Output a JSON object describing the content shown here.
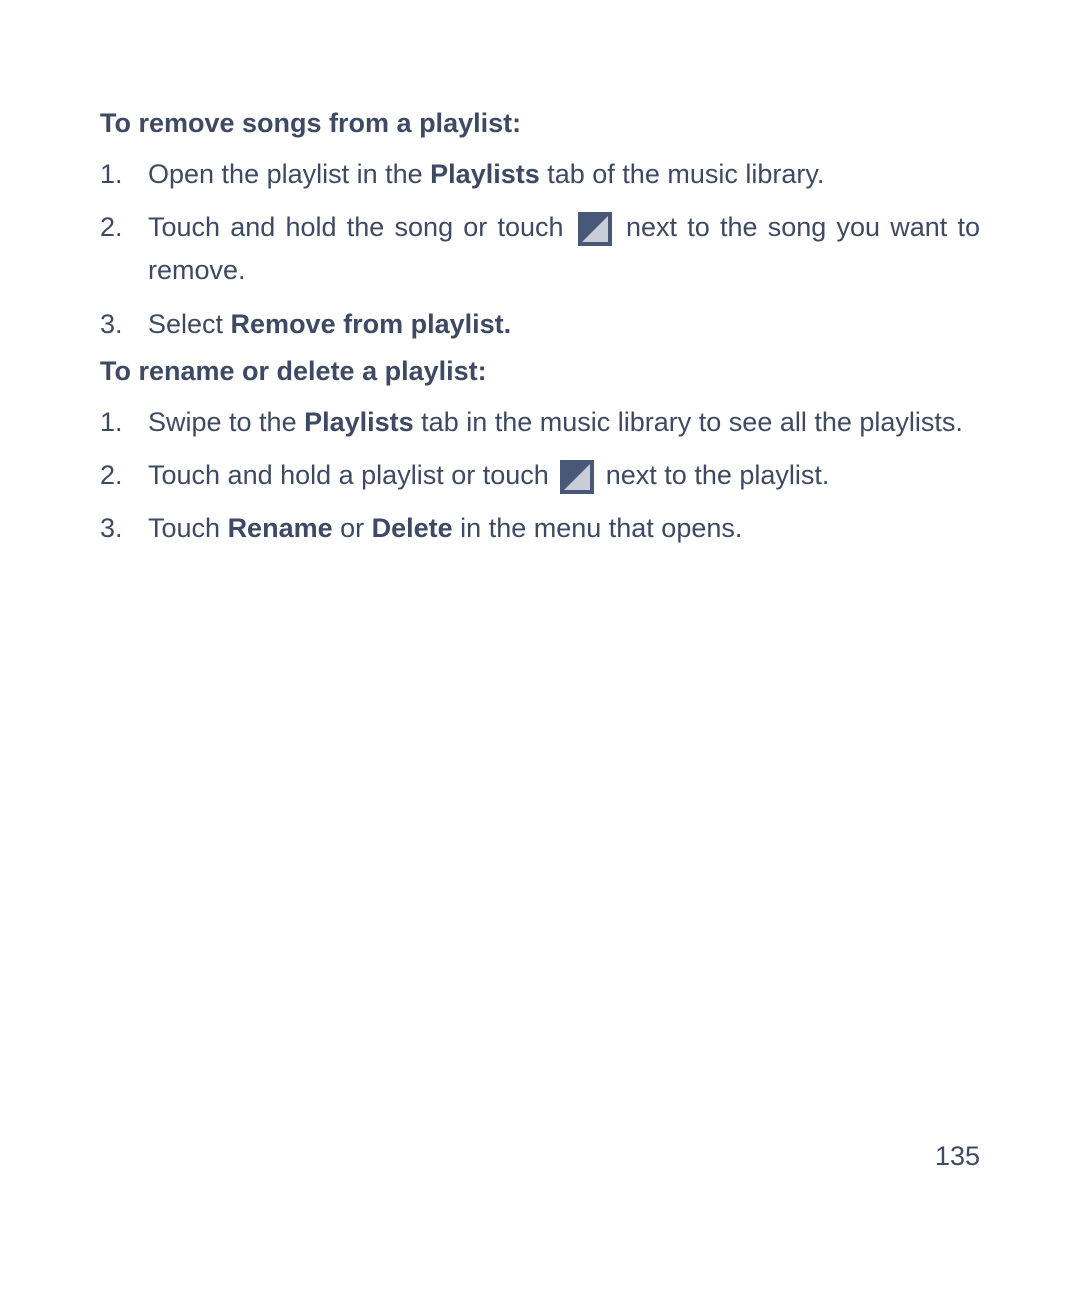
{
  "section1": {
    "heading": "To remove songs from a playlist:",
    "steps": [
      {
        "num": "1.",
        "pre": "Open the playlist in the ",
        "bold1": "Playlists",
        "post": " tab of the music library."
      },
      {
        "num": "2.",
        "pre": "Touch and hold the song or touch ",
        "post": " next to the song you want to remove."
      },
      {
        "num": "3.",
        "pre": "Select ",
        "bold1": "Remove from playlist."
      }
    ]
  },
  "section2": {
    "heading": "To rename or delete a playlist:",
    "steps": [
      {
        "num": "1.",
        "pre": "Swipe to the ",
        "bold1": "Playlists",
        "mid": " tab in the music library to see all the playlists."
      },
      {
        "num": "2.",
        "pre": "Touch and hold a playlist or touch ",
        "post": " next to the playlist."
      },
      {
        "num": "3.",
        "pre": "Touch ",
        "bold1": "Rename",
        "mid": " or ",
        "bold2": "Delete",
        "post": " in the menu that opens."
      }
    ]
  },
  "pageNumber": "135"
}
